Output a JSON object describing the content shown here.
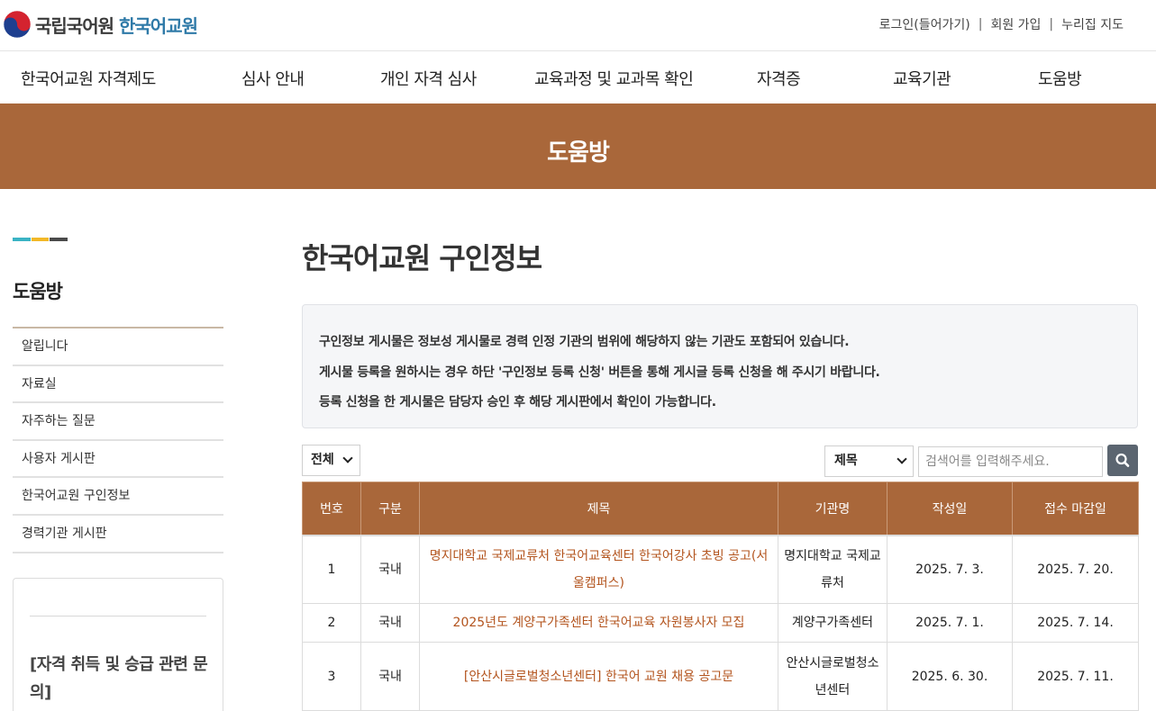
{
  "header": {
    "org_name": "국립국어원",
    "site_name": "한국어교원",
    "util_links": [
      "로그인(들어가기)",
      "회원 가입",
      "누리집 지도"
    ]
  },
  "gnb": [
    "한국어교원 자격제도",
    "심사 안내",
    "개인 자격 심사",
    "교육과정 및 교과목 확인",
    "자격증",
    "교육기관",
    "도움방"
  ],
  "banner": {
    "title": "도움방"
  },
  "colors": {
    "brand": "#a9673a",
    "accent_bar": [
      "#3ab3c4",
      "#f2b827",
      "#4a4a4a"
    ],
    "link_title": "#b3541e",
    "search_button": "#5b6570"
  },
  "sidebar": {
    "title": "도움방",
    "items": [
      "알립니다",
      "자료실",
      "자주하는 질문",
      "사용자 게시판",
      "한국어교원 구인정보",
      "경력기관 게시판"
    ],
    "box_text": "[자격 취득 및 승급 관련 문의]"
  },
  "main": {
    "title": "한국어교원 구인정보",
    "notice": [
      "구인정보 게시물은 정보성 게시물로 경력 인정 기관의 범위에 해당하지 않는 기관도 포함되어 있습니다.",
      "게시물 등록을 원하시는 경우 하단 '구인정보 등록 신청' 버튼을 통해 게시글 등록 신청을 해 주시기 바랍니다.",
      "등록 신청을 한 게시물은 담당자 승인 후 해당 게시판에서 확인이 가능합니다."
    ],
    "filter": {
      "category_selected": "전체",
      "field_selected": "제목",
      "search_placeholder": "검색어를 입력해주세요.",
      "search_icon": "search-icon"
    },
    "table": {
      "headers": [
        "번호",
        "구분",
        "제목",
        "기관명",
        "작성일",
        "접수 마감일"
      ],
      "rows": [
        {
          "no": "1",
          "type": "국내",
          "title": "명지대학교 국제교류처 한국어교육센터 한국어강사 초빙 공고(서울캠퍼스)",
          "org": "명지대학교 국제교류처",
          "posted": "2025. 7. 3.",
          "deadline": "2025. 7. 20."
        },
        {
          "no": "2",
          "type": "국내",
          "title": "2025년도 계양구가족센터 한국어교육 자원봉사자 모집",
          "org": "계양구가족센터",
          "posted": "2025. 7. 1.",
          "deadline": "2025. 7. 14."
        },
        {
          "no": "3",
          "type": "국내",
          "title": "[안산시글로벌청소년센터] 한국어 교원 채용 공고문",
          "org": "안산시글로벌청소년센터",
          "posted": "2025. 6. 30.",
          "deadline": "2025. 7. 11."
        }
      ]
    }
  }
}
